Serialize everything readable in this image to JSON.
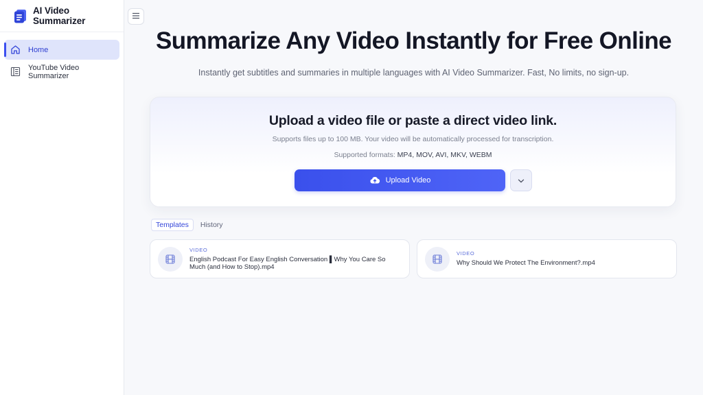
{
  "brand": {
    "title": "AI Video Summarizer",
    "logo": "document-stack-icon"
  },
  "sidebar": {
    "items": [
      {
        "label": "Home",
        "icon": "home-icon",
        "active": true
      },
      {
        "label": "YouTube Video Summarizer",
        "icon": "document-list-icon",
        "active": false
      }
    ]
  },
  "header": {
    "menu_icon": "hamburger-icon"
  },
  "hero": {
    "title": "Summarize Any Video Instantly for Free Online",
    "subtitle": "Instantly get subtitles and summaries in multiple languages with AI Video Summarizer. Fast, No limits, no sign-up."
  },
  "upload": {
    "title": "Upload a video file or paste a direct video link.",
    "note": "Supports files up to 100 MB. Your video will be automatically processed for transcription.",
    "formats_label": "Supported formats:",
    "formats": "MP4, MOV, AVI, MKV, WEBM",
    "button_label": "Upload Video",
    "button_icon": "cloud-upload-icon",
    "dropdown_icon": "chevron-down-icon"
  },
  "tabs": [
    {
      "label": "Templates",
      "active": true
    },
    {
      "label": "History",
      "active": false
    }
  ],
  "videos": [
    {
      "type": "VIDEO",
      "name": "English Podcast For Easy English Conversation ▌Why You Care So Much (and How to Stop).mp4",
      "icon": "film-icon"
    },
    {
      "type": "VIDEO",
      "name": "Why Should We Protect The Environment?.mp4",
      "icon": "film-icon"
    }
  ],
  "colors": {
    "accent": "#3b4ff0",
    "active_bg": "#dfe4fb",
    "background": "#f7f8fb"
  }
}
